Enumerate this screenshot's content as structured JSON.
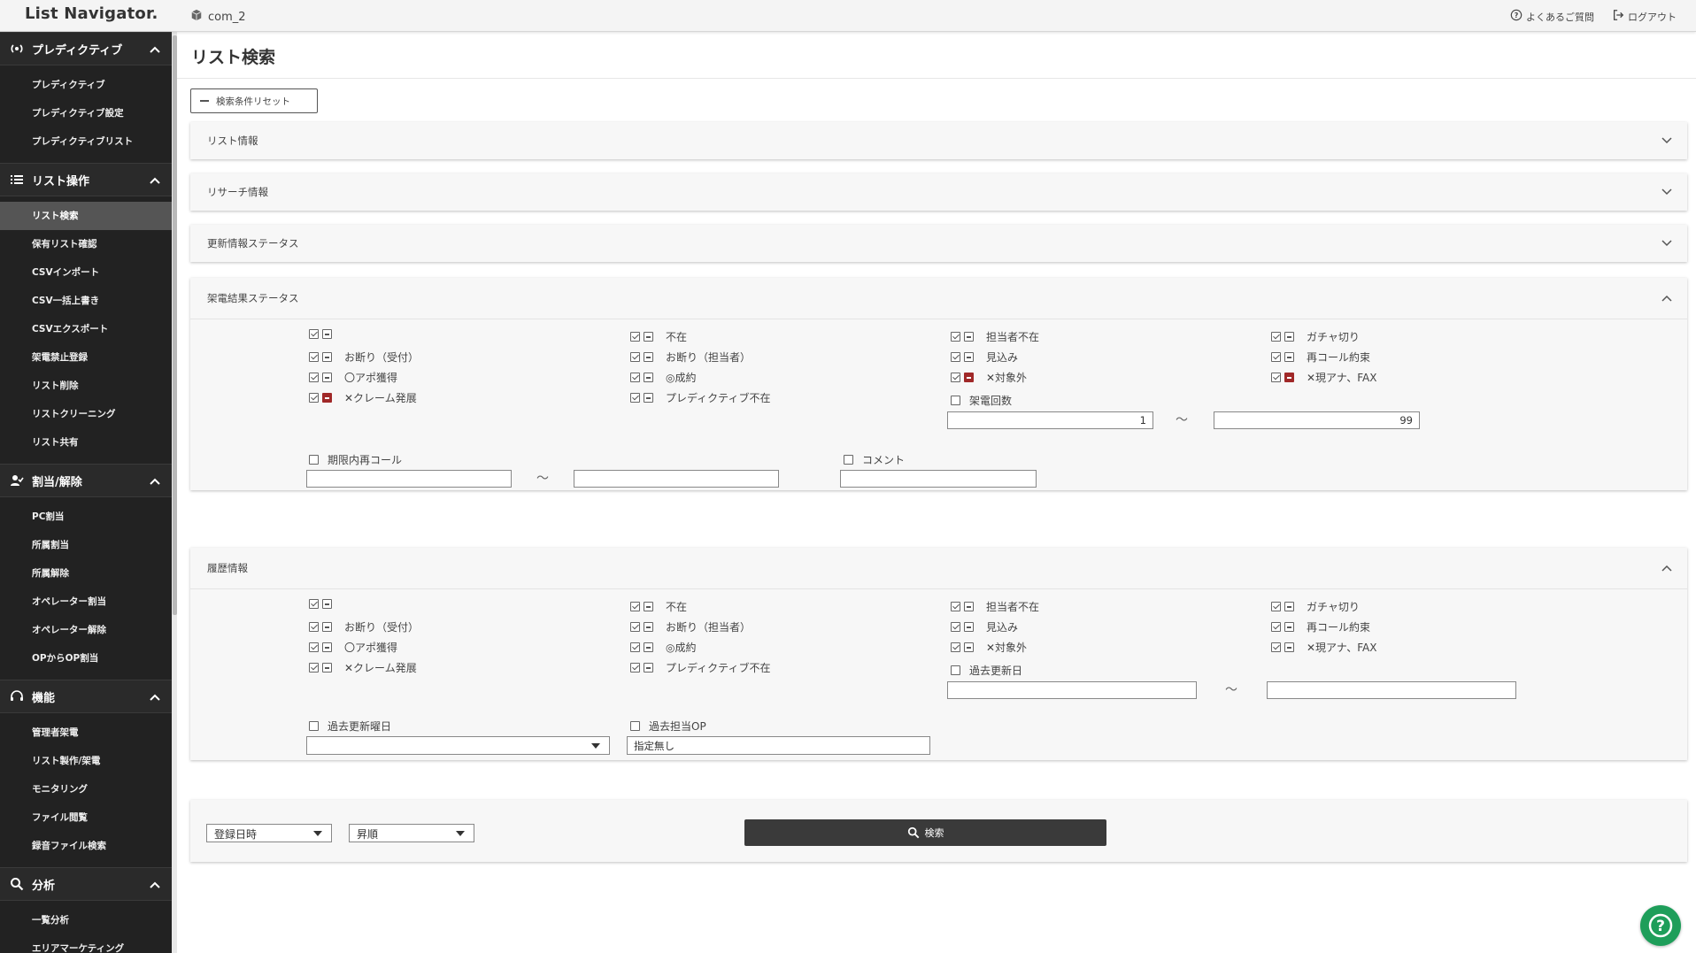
{
  "app": {
    "logo": "List Navigator.",
    "company": "com_2"
  },
  "header": {
    "faq": "よくあるご質問",
    "logout": "ログアウト"
  },
  "sidebar": {
    "sections": [
      {
        "label": "プレディクティブ",
        "icon": "broadcast-icon",
        "items": [
          "プレディクティブ",
          "プレディクティブ設定",
          "プレディクティブリスト"
        ]
      },
      {
        "label": "リスト操作",
        "icon": "list-icon",
        "items": [
          "リスト検索",
          "保有リスト確認",
          "CSVインポート",
          "CSV一括上書き",
          "CSVエクスポート",
          "架電禁止登録",
          "リスト削除",
          "リストクリーニング",
          "リスト共有"
        ]
      },
      {
        "label": "割当/解除",
        "icon": "user-check-icon",
        "items": [
          "PC割当",
          "所属割当",
          "所属解除",
          "オペレーター割当",
          "オペレーター解除",
          "OPからOP割当"
        ]
      },
      {
        "label": "機能",
        "icon": "headset-icon",
        "items": [
          "管理者架電",
          "リスト製作/架電",
          "モニタリング",
          "ファイル閲覧",
          "録音ファイル検索"
        ]
      },
      {
        "label": "分析",
        "icon": "search-icon",
        "items": [
          "一覧分析",
          "エリアマーケティング"
        ]
      }
    ],
    "active_item": "リスト検索"
  },
  "page": {
    "title": "リスト検索",
    "reset_button": "検索条件リセット"
  },
  "panels": {
    "list_info": "リスト情報",
    "research_info": "リサーチ情報",
    "update_status": "更新情報ステータス",
    "call_result": {
      "title": "架電結果ステータス",
      "statuses": [
        [
          "",
          "お断り（受付）",
          "〇アポ獲得",
          "✕クレーム発展"
        ],
        [
          "不在",
          "お断り（担当者）",
          "◎成約",
          "プレディクティブ不在"
        ],
        [
          "担当者不在",
          "見込み",
          "✕対象外"
        ],
        [
          "ガチャ切り",
          "再コール約束",
          "✕現アナ、FAX"
        ]
      ],
      "call_count_label": "架電回数",
      "call_count_min": "1",
      "call_count_max": "99",
      "recall_label": "期限内再コール",
      "comment_label": "コメント",
      "tilde": "～"
    },
    "history": {
      "title": "履歴情報",
      "statuses": [
        [
          "",
          "お断り（受付）",
          "〇アポ獲得",
          "✕クレーム発展"
        ],
        [
          "不在",
          "お断り（担当者）",
          "◎成約",
          "プレディクティブ不在"
        ],
        [
          "担当者不在",
          "見込み",
          "✕対象外"
        ],
        [
          "ガチャ切り",
          "再コール約束",
          "✕現アナ、FAX"
        ]
      ],
      "past_update_date_label": "過去更新日",
      "past_weekday_label": "過去更新曜日",
      "past_op_label": "過去担当OP",
      "past_op_value": "指定無し",
      "tilde": "～"
    }
  },
  "sort": {
    "field": "登録日時",
    "order": "昇順",
    "search_button": "検索"
  },
  "colors": {
    "sidebar_bg": "#222222",
    "active_item": "#555555",
    "red_check": "#a02828",
    "help_fab": "#1e9e5a",
    "search_button": "#3a3a3a"
  }
}
